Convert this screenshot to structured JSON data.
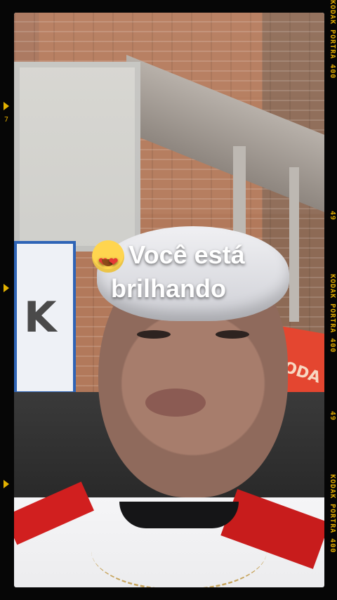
{
  "overlay": {
    "text_line1": "Você está",
    "text_line2": "brilhando"
  },
  "film": {
    "left_number": "7",
    "right_labels": [
      "KODAK PORTRA 400",
      "49",
      "KODAK PORTRA 400",
      "49",
      "KODAK PORTRA 400"
    ]
  },
  "photo": {
    "sign_left_letter": "K",
    "sign_right_text": "ODA"
  }
}
